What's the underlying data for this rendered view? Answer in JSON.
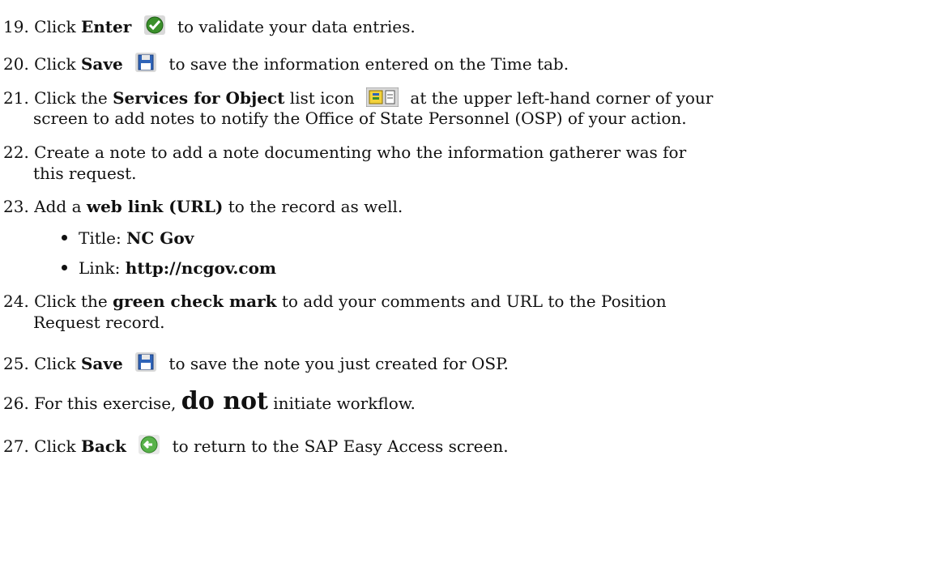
{
  "steps": [
    {
      "num": "19.",
      "pre": "Click ",
      "bold": "Enter",
      "post": " to validate your data entries.",
      "icon": "enter-check-icon"
    },
    {
      "num": "20.",
      "pre": "Click ",
      "bold": "Save",
      "post": " to save the information entered on the Time tab.",
      "icon": "save-floppy-icon"
    },
    {
      "num": "21.",
      "pre": "Click the ",
      "bold": "Services for Object",
      "mid": " list icon",
      "post": " at the upper left-hand corner of your",
      "cont": "screen to add notes to notify the Office of State Personnel (OSP) of your action.",
      "icon": "services-for-object-icon"
    },
    {
      "num": "22.",
      "text": "Create a note to add a note documenting who the information gatherer was for",
      "cont": "this request."
    },
    {
      "num": "23.",
      "pre": "Add a ",
      "bold": "web link (URL)",
      "post": " to the record as well."
    },
    {
      "bullet_label": "Title:  ",
      "bullet_value": "NC Gov"
    },
    {
      "bullet_label": "Link:  ",
      "bullet_value": "http://ncgov.com"
    },
    {
      "num": "24.",
      "pre": "Click the ",
      "bold": "green check mark",
      "post": " to add your comments and URL to the Position",
      "cont": "Request record."
    },
    {
      "num": "25.",
      "pre": "Click ",
      "bold": "Save",
      "post": " to save the note you just created for OSP.",
      "icon": "save-floppy-icon"
    },
    {
      "num": "26.",
      "pre": "For this exercise, ",
      "bold": "do not",
      "post": " initiate workflow."
    },
    {
      "num": "27.",
      "pre": "Click ",
      "bold": "Back",
      "post": " to return to the SAP Easy Access screen.",
      "icon": "back-arrow-icon"
    }
  ],
  "colors": {
    "icon_green": "#3a8f2a",
    "icon_blue": "#2f64b8",
    "icon_bg": "#d9d9d9",
    "back_green": "#58b24a"
  }
}
